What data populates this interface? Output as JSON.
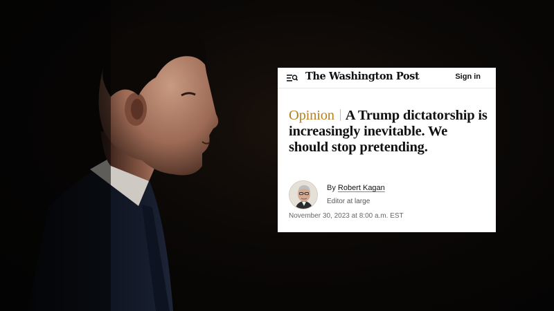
{
  "article": {
    "masthead": "The Washington Post",
    "signin_label": "Sign in",
    "kicker": "Opinion",
    "headline": "A Trump dictatorship is increasingly inevitable. We should stop pretending.",
    "byline_prefix": "By",
    "author": "Robert Kagan",
    "author_role": "Editor at large",
    "timestamp": "November 30, 2023 at 8:00 a.m. EST"
  },
  "icons": {
    "menu": "menu-search-icon",
    "avatar": "author-photo"
  },
  "colors": {
    "background": "#050505",
    "card": "#ffffff",
    "kicker": "#b5801f",
    "text": "#111111"
  }
}
